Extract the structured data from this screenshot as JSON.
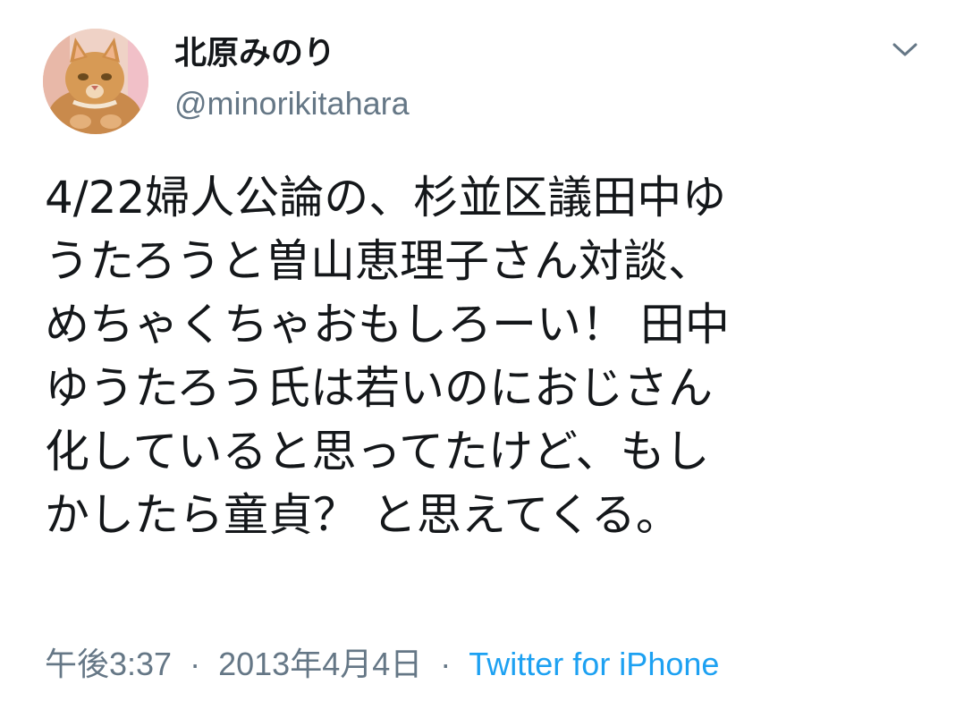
{
  "tweet": {
    "author": {
      "display_name": "北原みのり",
      "handle": "@minorikitahara",
      "avatar_icon": "cat-avatar-icon"
    },
    "menu_icon": "chevron-down-icon",
    "text_lines": [
      "4/22婦人公論の、杉並区議田中ゆ",
      "うたろうと曽山恵理子さん対談、",
      "めちゃくちゃおもしろーい！ 田中",
      "ゆうたろう氏は若いのにおじさん",
      "化していると思ってたけど、もし",
      "かしたら童貞？ と思えてくる。"
    ],
    "time": "午後3:37",
    "separator": "·",
    "date": "2013年4月4日",
    "source": "Twitter for iPhone"
  },
  "colors": {
    "text": "#14171a",
    "secondary": "#657786",
    "link": "#1da1f2",
    "background": "#ffffff"
  }
}
